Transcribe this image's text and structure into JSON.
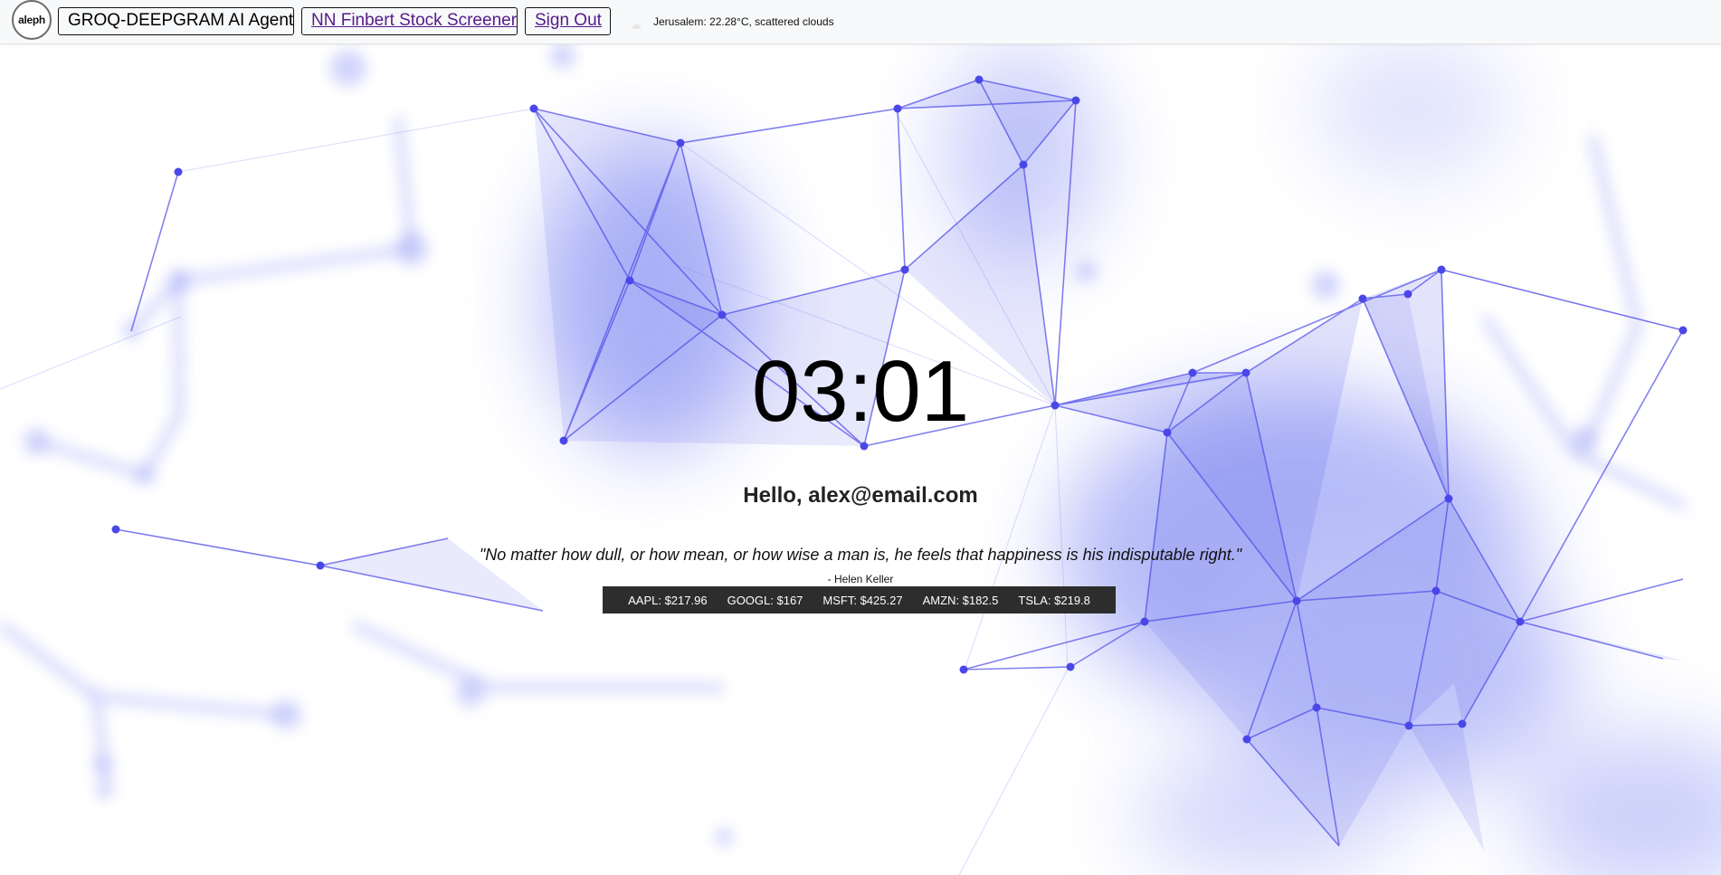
{
  "nav": {
    "logo_text": "aleph",
    "agent_label": "GROQ-DEEPGRAM AI Agent",
    "finbert_label": "NN Finbert Stock Screener",
    "signout_label": "Sign Out"
  },
  "weather": {
    "icon": "cloud-icon",
    "text": "Jerusalem: 22.28°C, scattered clouds"
  },
  "clock": {
    "time": "03:01"
  },
  "greeting": {
    "text": "Hello, alex@email.com"
  },
  "quote": {
    "text": "\"No matter how dull, or how mean, or how wise a man is, he feels that happiness is his indisputable right.\"",
    "author": "- Helen Keller"
  },
  "stocks": [
    {
      "label": "AAPL: $217.96"
    },
    {
      "label": "GOOGL: $167"
    },
    {
      "label": "MSFT: $425.27"
    },
    {
      "label": "AMZN: $182.5"
    },
    {
      "label": "TSLA: $219.8"
    }
  ],
  "colors": {
    "network_node": "#4a47e8",
    "network_fill": "#8e96f5",
    "ticker_bg": "#2d2d2d",
    "link_visited": "#551a8b"
  }
}
